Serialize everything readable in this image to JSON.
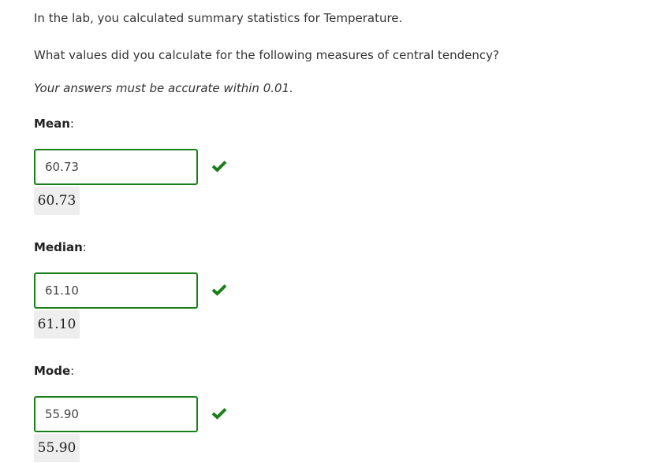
{
  "intro": "In the lab, you calculated summary statistics for Temperature.",
  "question": "What values did you calculate for the following measures of central tendency?",
  "note": "Your answers must be accurate within 0.01.",
  "accent": "#1a7f1a",
  "fields": [
    {
      "label": "Mean",
      "value": "60.73",
      "preview": "60.73",
      "status": "correct"
    },
    {
      "label": "Median",
      "value": "61.10",
      "preview": "61.10",
      "status": "correct"
    },
    {
      "label": "Mode",
      "value": "55.90",
      "preview": "55.90",
      "status": "correct"
    }
  ]
}
